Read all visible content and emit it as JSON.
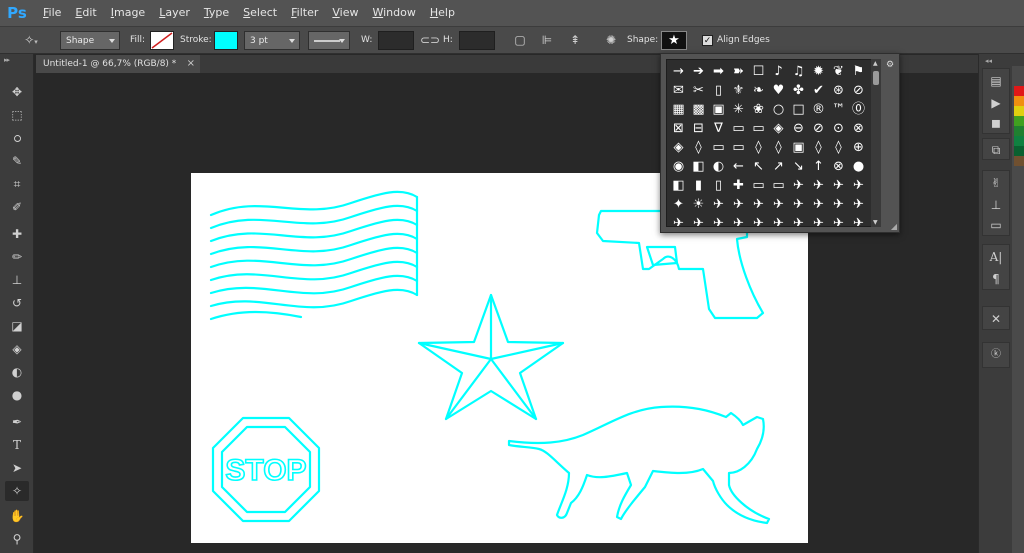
{
  "app": {
    "logo_text": "Ps"
  },
  "menu": [
    "File",
    "Edit",
    "Image",
    "Layer",
    "Type",
    "Select",
    "Filter",
    "View",
    "Window",
    "Help"
  ],
  "options_bar": {
    "tool_mode": "Shape",
    "fill_label": "Fill:",
    "stroke_label": "Stroke:",
    "stroke_color": "#00ffff",
    "stroke_width": "3 pt",
    "w_label": "W:",
    "h_label": "H:",
    "shape_label": "Shape:",
    "align_edges_label": "Align Edges",
    "align_edges_checked": true
  },
  "document": {
    "tab_title": "Untitled-1 @ 66,7% (RGB/8) *",
    "tab_close": "×",
    "stroke_color": "#00ffff",
    "stop_text": "STOP"
  },
  "shape_picker": {
    "columns": 10,
    "glyphs": [
      "→",
      "➔",
      "➡",
      "➽",
      "☐",
      "♪",
      "♫",
      "✹",
      "❦",
      "⚑",
      "✉",
      "✂",
      "▯",
      "⚜",
      "❧",
      "♥",
      "✤",
      "✔",
      "⊛",
      "⊘",
      "▦",
      "▩",
      "▣",
      "✳",
      "❀",
      "○",
      "□",
      "®",
      "™",
      "⓪",
      "⊠",
      "⊟",
      "∇",
      "▭",
      "▭",
      "◈",
      "⊖",
      "⊘",
      "⊙",
      "⊗",
      "◈",
      "◊",
      "▭",
      "▭",
      "◊",
      "◊",
      "▣",
      "◊",
      "◊",
      "⊕",
      "◉",
      "◧",
      "◐",
      "←",
      "↖",
      "↗",
      "↘",
      "↑",
      "⊗",
      "●",
      "◧",
      "▮",
      "▯",
      "✚",
      "▭",
      "▭",
      "✈",
      "✈",
      "✈",
      "✈",
      "✦",
      "☀",
      "✈",
      "✈",
      "✈",
      "✈",
      "✈",
      "✈",
      "✈",
      "✈",
      "✈",
      "✈",
      "✈",
      "✈",
      "✈",
      "✈",
      "✈",
      "✈",
      "✈",
      "✈"
    ]
  }
}
